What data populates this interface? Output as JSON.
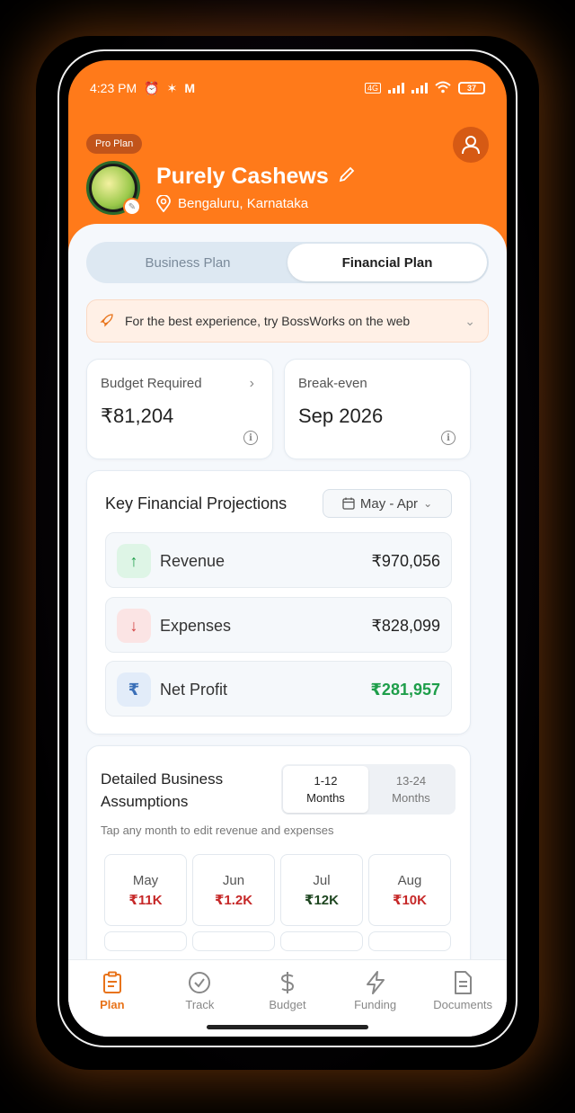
{
  "status_bar": {
    "time": "4:23 PM",
    "battery": "37"
  },
  "header": {
    "plan_badge": "Pro Plan",
    "business_name": "Purely Cashews",
    "location": "Bengaluru, Karnataka"
  },
  "tabs": [
    {
      "label": "Business Plan",
      "active": false
    },
    {
      "label": "Financial Plan",
      "active": true
    }
  ],
  "banner": {
    "text": "For the best experience, try BossWorks on the web"
  },
  "stats": {
    "budget_label": "Budget Required",
    "budget_value": "₹81,204",
    "breakeven_label": "Break-even",
    "breakeven_value": "Sep 2026"
  },
  "projections": {
    "title": "Key Financial Projections",
    "range": "May - Apr",
    "rows": [
      {
        "label": "Revenue",
        "value": "₹970,056"
      },
      {
        "label": "Expenses",
        "value": "₹828,099"
      },
      {
        "label": "Net Profit",
        "value": "₹281,957"
      }
    ]
  },
  "assumptions": {
    "title": "Detailed Business Assumptions",
    "toggle": [
      "1-12 Months",
      "13-24 Months"
    ],
    "toggle_line1": [
      "1-12",
      "13-24"
    ],
    "toggle_line2": [
      "Months",
      "Months"
    ],
    "hint": "Tap any month to edit revenue and expenses",
    "months": [
      {
        "month": "May",
        "value": "₹11K",
        "color": "#c62828"
      },
      {
        "month": "Jun",
        "value": "₹1.2K",
        "color": "#c62828"
      },
      {
        "month": "Jul",
        "value": "₹12K",
        "color": "#1e4620"
      },
      {
        "month": "Aug",
        "value": "₹10K",
        "color": "#c62828"
      }
    ]
  },
  "nav": [
    {
      "label": "Plan",
      "icon": "clipboard-icon",
      "active": true
    },
    {
      "label": "Track",
      "icon": "check-circle-icon",
      "active": false
    },
    {
      "label": "Budget",
      "icon": "dollar-icon",
      "active": false
    },
    {
      "label": "Funding",
      "icon": "lightning-icon",
      "active": false
    },
    {
      "label": "Documents",
      "icon": "document-icon",
      "active": false
    }
  ],
  "colors": {
    "accent": "#ff7a1a",
    "positive": "#1e9e4a",
    "negative": "#c62828"
  }
}
